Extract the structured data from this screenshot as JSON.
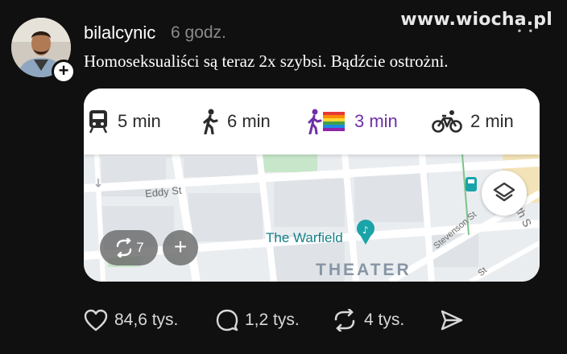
{
  "watermark": "www.wiocha.pl",
  "post": {
    "username": "bilalcynic",
    "time": "6 godz.",
    "text": "Homoseksualiści są teraz 2x szybsi. Bądźcie ostrożni.",
    "follow_symbol": "+"
  },
  "travel_modes": [
    {
      "icon": "train-icon",
      "label": "5 min"
    },
    {
      "icon": "walk-icon",
      "label": "6 min"
    },
    {
      "icon": "rainbow-walk-icon",
      "label": "3 min",
      "active": true
    },
    {
      "icon": "bike-icon",
      "label": "2 min"
    }
  ],
  "map": {
    "street_eddy": "Eddy St",
    "street_stevenson": "Stevenson St",
    "street_partial_1": "th S",
    "street_partial_2": "St",
    "place": "The Warfield",
    "district": "THEATER"
  },
  "overlay": {
    "repost_count": "7",
    "add_symbol": "+"
  },
  "actions": {
    "likes": "84,6 tys.",
    "comments": "1,2 tys.",
    "reposts": "4 tys."
  },
  "colors": {
    "background": "#101010",
    "active_mode": "#6f2fa8",
    "map_bg": "#eef0f2",
    "place_pin": "#1aa3a8"
  }
}
